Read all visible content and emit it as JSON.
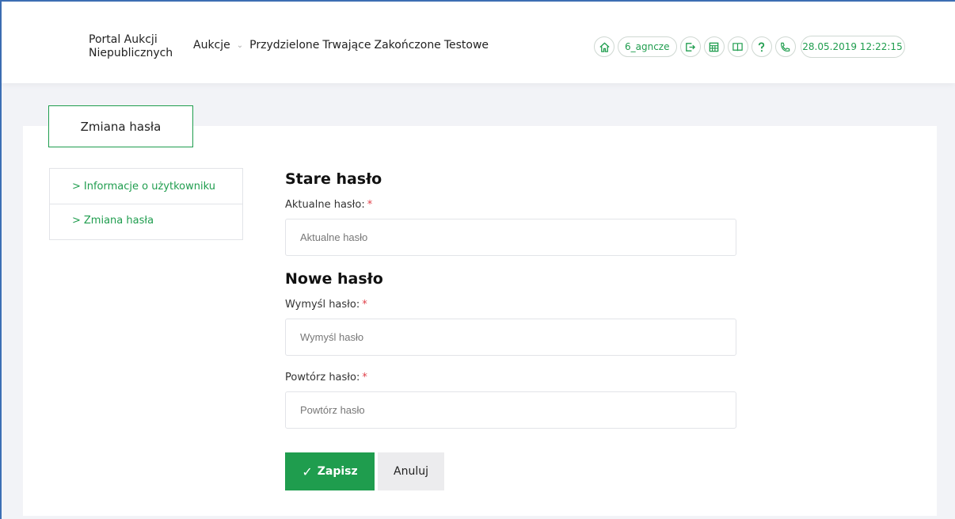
{
  "header": {
    "brand_line1": "Portal Aukcji",
    "brand_line2": "Niepublicznych",
    "nav": {
      "aukcje": "Aukcje",
      "przydzielone": "Przydzielone",
      "trwajace": "Trwające",
      "zakonczone": "Zakończone",
      "testowe": "Testowe"
    },
    "username": "6_agncze",
    "datetime": "28.05.2019 12:22:15"
  },
  "page": {
    "tab_title": "Zmiana hasła"
  },
  "sidebar": {
    "items": [
      {
        "label": "Informacje o użytkowniku"
      },
      {
        "label": "Zmiana hasła"
      }
    ]
  },
  "form": {
    "old_heading": "Stare hasło",
    "current_label": "Aktualne hasło:",
    "current_placeholder": "Aktualne hasło",
    "new_heading": "Nowe hasło",
    "new_label": "Wymyśl hasło:",
    "new_placeholder": "Wymyśl hasło",
    "repeat_label": "Powtórz hasło:",
    "repeat_placeholder": "Powtórz hasło",
    "required_mark": "*",
    "save_label": "Zapisz",
    "cancel_label": "Anuluj"
  },
  "colors": {
    "accent": "#1f9d4e",
    "required": "#e0404a",
    "frame": "#3d6fb5"
  },
  "icons": [
    "home-icon",
    "logout-icon",
    "calculator-icon",
    "book-icon",
    "help-icon",
    "phone-icon",
    "chevron-down-icon",
    "chevron-right-icon",
    "check-icon"
  ]
}
